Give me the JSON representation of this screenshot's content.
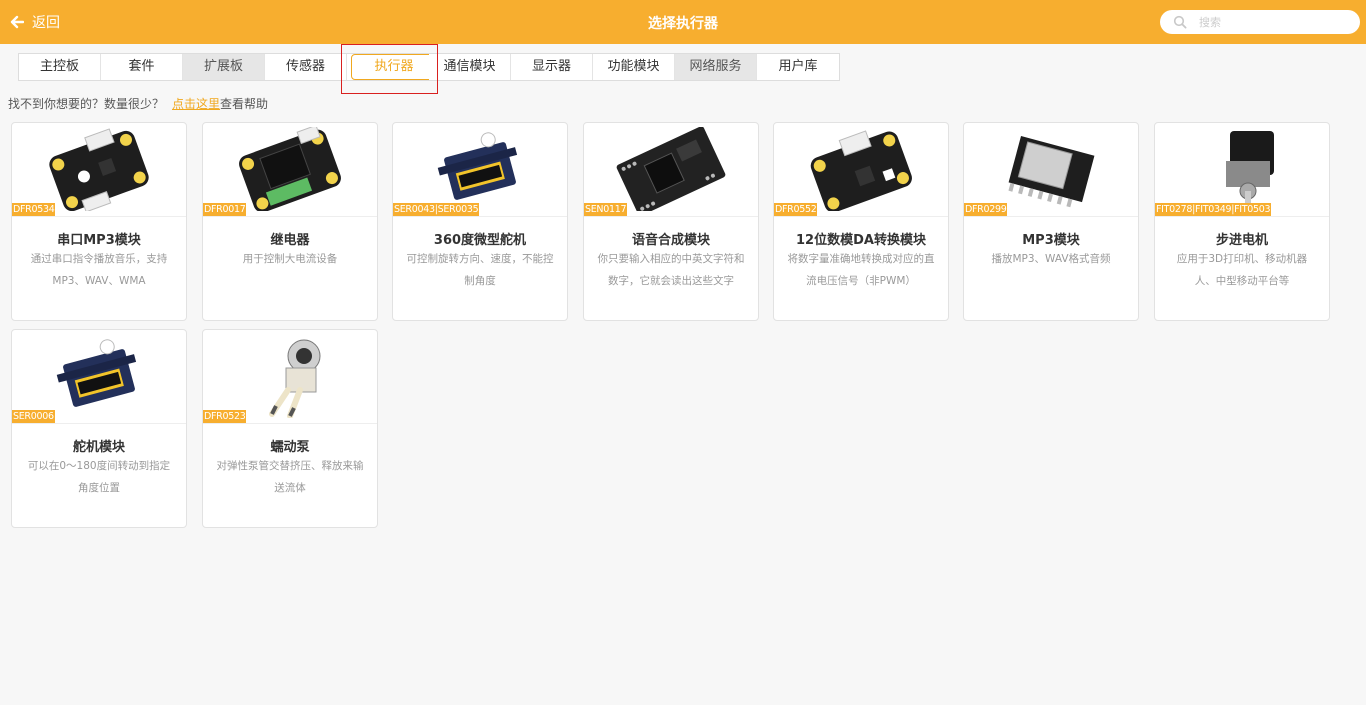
{
  "header": {
    "back_label": "返回",
    "title": "选择执行器",
    "search_placeholder": "搜索",
    "accent": "#f7ae2f"
  },
  "tabs": [
    {
      "label": "主控板",
      "state": "normal"
    },
    {
      "label": "套件",
      "state": "normal"
    },
    {
      "label": "扩展板",
      "state": "disabled"
    },
    {
      "label": "传感器",
      "state": "normal"
    },
    {
      "label": "执行器",
      "state": "active"
    },
    {
      "label": "通信模块",
      "state": "normal"
    },
    {
      "label": "显示器",
      "state": "normal"
    },
    {
      "label": "功能模块",
      "state": "normal"
    },
    {
      "label": "网络服务",
      "state": "disabled"
    },
    {
      "label": "用户库",
      "state": "normal"
    }
  ],
  "help": {
    "text": "找不到你想要的？数量很少？",
    "link": "点击这里",
    "suffix": "查看帮助"
  },
  "cards": [
    {
      "sku": "DFR0534",
      "name": "串口MP3模块",
      "desc": "通过串口指令播放音乐，支持MP3、WAV、WMA",
      "image_icon": "mp3-board-icon"
    },
    {
      "sku": "DFR0017",
      "name": "继电器",
      "desc": "用于控制大电流设备",
      "image_icon": "relay-icon"
    },
    {
      "sku": "SER0043|SER0035",
      "name": "360度微型舵机",
      "desc": "可控制旋转方向、速度，不能控制角度",
      "image_icon": "servo-icon"
    },
    {
      "sku": "SEN0117",
      "name": "语音合成模块",
      "desc": "你只要输入相应的中英文字符和数字，它就会读出这些文字",
      "image_icon": "speech-board-icon"
    },
    {
      "sku": "DFR0552",
      "name": "12位数模DA转换模块",
      "desc": "将数字量准确地转换成对应的直流电压信号（非PWM）",
      "image_icon": "dac-board-icon"
    },
    {
      "sku": "DFR0299",
      "name": "MP3模块",
      "desc": "播放MP3、WAV格式音频",
      "image_icon": "mp3-chip-icon"
    },
    {
      "sku": "FIT0278|FIT0349|FIT0503",
      "name": "步进电机",
      "desc": "应用于3D打印机、移动机器人、中型移动平台等",
      "image_icon": "stepper-motor-icon"
    },
    {
      "sku": "SER0006",
      "name": "舵机模块",
      "desc": "可以在0～180度间转动到指定角度位置",
      "image_icon": "servo-icon"
    },
    {
      "sku": "DFR0523",
      "name": "蠕动泵",
      "desc": "对弹性泵管交替挤压、释放来输送流体",
      "image_icon": "peristaltic-pump-icon"
    }
  ]
}
